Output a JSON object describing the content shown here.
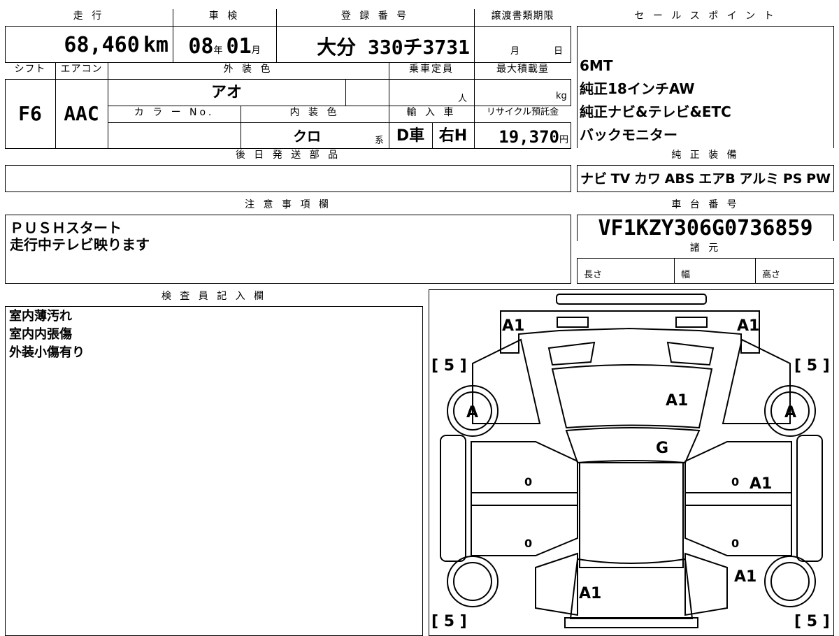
{
  "vehicle": {
    "mileage_label": "走 行",
    "mileage_value": "68,460",
    "mileage_unit": "km",
    "inspection_label": "車 検",
    "inspection_year": "08",
    "inspection_year_unit": "年",
    "inspection_month": "01",
    "inspection_month_unit": "月",
    "registration_label": "登 録 番 号",
    "registration_value": "大分 330チ3731",
    "transfer_label": "譲渡書類期限",
    "transfer_month": "月",
    "transfer_day": "日",
    "shift_label": "シフト",
    "shift_value": "F6",
    "aircon_label": "エアコン",
    "aircon_value": "AAC",
    "exterior_label": "外 装 色",
    "exterior_value": "アオ",
    "capacity_label": "乗車定員",
    "capacity_unit": "人",
    "load_label": "最大積載量",
    "load_unit": "kg",
    "color_no_label": "カ ラ ー No.",
    "interior_label": "内 装 色",
    "interior_value": "クロ",
    "interior_suffix": "系",
    "import_label": "輸 入 車",
    "import_drive": "D車",
    "import_handle": "右H",
    "recycle_label": "リサイクル預託金",
    "recycle_value": "19,370",
    "recycle_unit": "円",
    "later_parts_label": "後 日 発 送 部 品"
  },
  "sales": {
    "label": "セ ー ル ス ポ イ ン ト",
    "points": [
      "6MT",
      "純正18インチAW",
      "純正ナビ&テレビ&ETC",
      "バックモニター"
    ],
    "equipment_label": "純 正 装 備",
    "equipment": [
      "ナビ",
      "TV",
      "カワ",
      "ABS",
      "エアB",
      "アルミ",
      "PS",
      "PW"
    ]
  },
  "notes": {
    "label": "注 意 事 項 欄",
    "text": "ＰＵＳＨスタート\n走行中テレビ映ります"
  },
  "chassis": {
    "label": "車 台 番 号",
    "value": "VF1KZY306G0736859",
    "spec_label": "諸 元",
    "length_label": "長さ",
    "width_label": "幅",
    "height_label": "高さ"
  },
  "inspector": {
    "label": "検 査 員 記 入 欄",
    "lines": [
      "室内薄汚れ",
      "室内内張傷",
      "外装小傷有り"
    ]
  },
  "diagram": {
    "marks": {
      "front_left": "A1",
      "front_right": "A1",
      "tire_fl": "[ 5 ]",
      "tire_fr": "[ 5 ]",
      "tire_rl": "[ 5 ]",
      "tire_rr": "[ 5 ]",
      "wheel_fl": "A",
      "wheel_fr": "A",
      "hood": "A1",
      "windshield": "G",
      "door_fl": "0",
      "door_fr": "0",
      "door_fr_mark": "A1",
      "door_rl": "0",
      "door_rr": "0",
      "rear_right": "A1",
      "trunk": "A1"
    }
  }
}
